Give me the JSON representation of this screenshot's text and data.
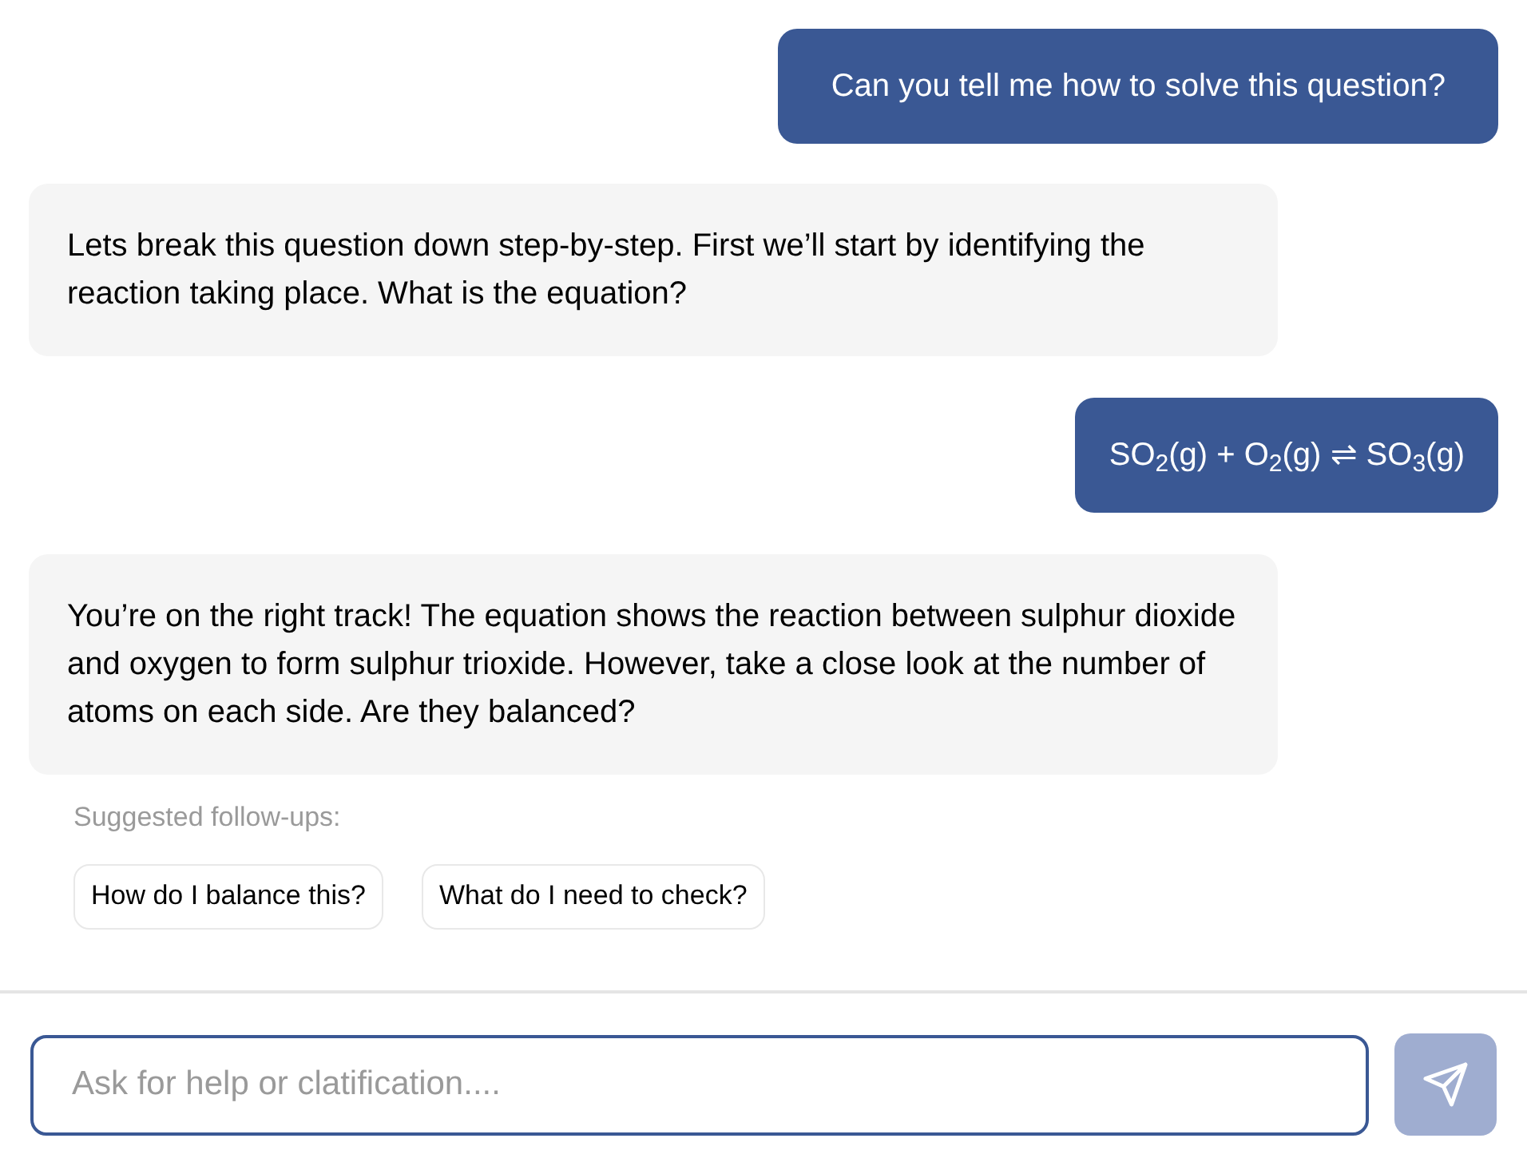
{
  "messages": [
    {
      "kind": "user",
      "text": "Can you tell me how to solve this question?"
    },
    {
      "kind": "assistant",
      "text": "Lets break this question down step-by-step. First we’ll start by identifying the reaction taking place. What is the equation?"
    },
    {
      "kind": "user",
      "text": "SO$_{2}$(g) + O$_{2}$(g) ⇌ SO$_{3}$(g)"
    },
    {
      "kind": "assistant",
      "text": "You’re on the right track! The equation shows the reaction between sulphur dioxide and oxygen to form sulphur trioxide. However, take a close look at the number of atoms on each side. Are they balanced?"
    }
  ],
  "suggestions": {
    "label": "Suggested follow-ups:",
    "items": [
      "How do I balance this?",
      "What do I need to check?"
    ]
  },
  "composer": {
    "placeholder": "Ask for help or clatification....",
    "send_disabled": true
  }
}
